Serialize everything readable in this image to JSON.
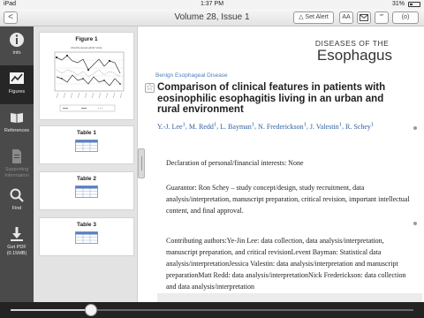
{
  "status_bar": {
    "carrier": "iPad",
    "time": "1:37 PM",
    "battery": "31%"
  },
  "toolbar": {
    "issue_title": "Volume 28, Issue 1",
    "back_label": "<",
    "set_alert_label": "Set Alert",
    "font_label": "AA",
    "quote_label": "“”",
    "share_label": "(o)"
  },
  "nav": {
    "items": [
      {
        "label": "Info",
        "icon": "info-icon",
        "state": "normal"
      },
      {
        "label": "Figures",
        "icon": "chart-icon",
        "state": "active"
      },
      {
        "label": "References",
        "icon": "book-icon",
        "state": "normal"
      },
      {
        "label": "Supporting Information",
        "icon": "document-icon",
        "state": "disabled"
      },
      {
        "label": "Find",
        "icon": "search-icon",
        "state": "normal"
      },
      {
        "label": "Get PDF (0.15MB)",
        "icon": "download-icon",
        "state": "normal"
      }
    ]
  },
  "thumbnails": [
    {
      "title": "Figure 1",
      "kind": "figure"
    },
    {
      "title": "Table 1",
      "kind": "table"
    },
    {
      "title": "Table 2",
      "kind": "table"
    },
    {
      "title": "Table 3",
      "kind": "table"
    }
  ],
  "article": {
    "journal_top": "DISEASES OF THE",
    "journal_bottom": "Esophagus",
    "category": "Benign Esophageal Disease",
    "title": "Comparison of clinical features in patients with eosinophilic esophagitis living in an urban and rural environment",
    "authors": [
      {
        "name": "Y.-J. Lee",
        "sup": "1"
      },
      {
        "name": "M. Redd",
        "sup": "1"
      },
      {
        "name": "L. Bayman",
        "sup": "1"
      },
      {
        "name": "N. Frederickson",
        "sup": "1"
      },
      {
        "name": "J. Valestin",
        "sup": "1"
      },
      {
        "name": "R. Schey",
        "sup": "1"
      }
    ],
    "paragraphs": [
      "Declaration of personal/financial interests: None",
      "Guarantor: Ron Schey – study concept/design, study recruitment, data analysis/interpretation, manuscript preparation, critical revision, important intellectual content, and final approval.",
      "Contributing authors:Ye-Jin Lee: data collection, data analysis/interpretation, manuscript preparation, and critical revisionLevent Bayman: Statistical data analysis/interpretationJessica Valestin: data analysis/interpretation and manuscript preparationMatt Redd: data analysis/interpretationNick Frederickson: data collection and data analysis/interpretation"
    ]
  },
  "slider": {
    "position_fraction": 0.2
  },
  "colors": {
    "accent_link": "#2d60a4",
    "category": "#4f82b8",
    "nav_bg": "#4a4a4a",
    "nav_active": "#262626"
  }
}
